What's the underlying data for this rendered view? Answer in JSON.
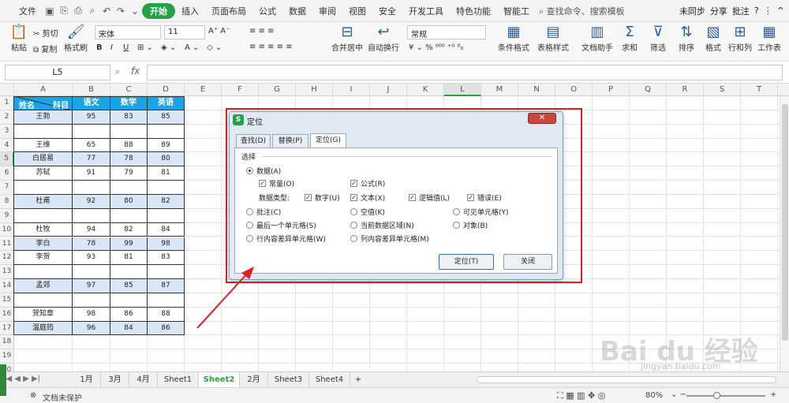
{
  "menubar": {
    "file": "文件",
    "tabs": [
      "开始",
      "插入",
      "页面布局",
      "公式",
      "数据",
      "审阅",
      "视图",
      "安全",
      "开发工具",
      "特色功能",
      "智能工"
    ],
    "active_tab": "开始",
    "search": "查找命令、搜索模板",
    "sync": "未同步",
    "share": "分享",
    "comment": "批注"
  },
  "ribbon": {
    "paste": "粘贴",
    "cut": "剪切",
    "copy": "复制",
    "format_painter": "格式刷",
    "font_name": "宋体",
    "font_size": "11",
    "merge_center": "合并居中",
    "wrap_text": "自动换行",
    "number_format": "常规",
    "cond_format": "条件格式",
    "table_style": "表格样式",
    "doc_helper": "文档助手",
    "sum": "求和",
    "filter": "筛选",
    "sort": "排序",
    "format": "格式",
    "row_col": "行和列",
    "sheet": "工作表"
  },
  "formula_bar": {
    "name_box": "L5",
    "fx": "fx"
  },
  "columns": [
    "A",
    "B",
    "C",
    "D",
    "E",
    "F",
    "G",
    "H",
    "I",
    "J",
    "K",
    "L",
    "M",
    "N",
    "O",
    "P",
    "Q",
    "R",
    "S",
    "T",
    "U"
  ],
  "rows": [
    "1",
    "2",
    "3",
    "4",
    "5",
    "6",
    "7",
    "8",
    "9",
    "10",
    "11",
    "12",
    "13",
    "14",
    "15",
    "16",
    "17",
    "18",
    "19",
    "20"
  ],
  "table": {
    "header_left": "姓名",
    "header_right": "科目",
    "headers": [
      "语文",
      "数学",
      "英语"
    ],
    "rows": [
      [
        "王勃",
        "95",
        "83",
        "85"
      ],
      [
        "",
        "",
        "",
        ""
      ],
      [
        "王维",
        "65",
        "88",
        "89"
      ],
      [
        "白居易",
        "77",
        "78",
        "80"
      ],
      [
        "苏轼",
        "91",
        "79",
        "81"
      ],
      [
        "",
        "",
        "",
        ""
      ],
      [
        "杜甫",
        "92",
        "80",
        "82"
      ],
      [
        "",
        "",
        "",
        ""
      ],
      [
        "杜牧",
        "94",
        "82",
        "84"
      ],
      [
        "李白",
        "78",
        "99",
        "98"
      ],
      [
        "李贺",
        "93",
        "81",
        "83"
      ],
      [
        "",
        "",
        "",
        ""
      ],
      [
        "孟郊",
        "97",
        "85",
        "87"
      ],
      [
        "",
        "",
        "",
        ""
      ],
      [
        "贺知章",
        "98",
        "86",
        "88"
      ],
      [
        "温庭筠",
        "96",
        "84",
        "86"
      ]
    ]
  },
  "dialog": {
    "title": "定位",
    "tabs": [
      "查找(D)",
      "替换(P)",
      "定位(G)"
    ],
    "section": "选择",
    "opt_data": "数据(A)",
    "opt_const": "常量(O)",
    "opt_formula": "公式(R)",
    "data_type_label": "数据类型:",
    "type_number": "数字(U)",
    "type_text": "文本(X)",
    "type_logic": "逻辑值(L)",
    "type_error": "错误(E)",
    "opt_comment": "批注(C)",
    "opt_blank": "空值(K)",
    "opt_visible": "可见单元格(Y)",
    "opt_last": "最后一个单元格(S)",
    "opt_region": "当前数据区域(N)",
    "opt_object": "对象(B)",
    "opt_rowdiff": "行内容差异单元格(W)",
    "opt_coldiff": "列内容差异单元格(M)",
    "ok": "定位(T)",
    "close": "关闭"
  },
  "sheet_tabs": [
    "1月",
    "3月",
    "4月",
    "Sheet1",
    "Sheet2",
    "2月",
    "Sheet3",
    "Sheet4"
  ],
  "active_sheet": "Sheet2",
  "status": {
    "protect": "文档未保护",
    "zoom": "80%"
  },
  "watermark": {
    "brand": "Bai du 经验",
    "url": "jingyan.baidu.com"
  },
  "colors": {
    "accent_green": "#25a244",
    "header_blue": "#1aa3e6",
    "row_blue": "#d9e6f5",
    "highlight_red": "#e02020"
  }
}
